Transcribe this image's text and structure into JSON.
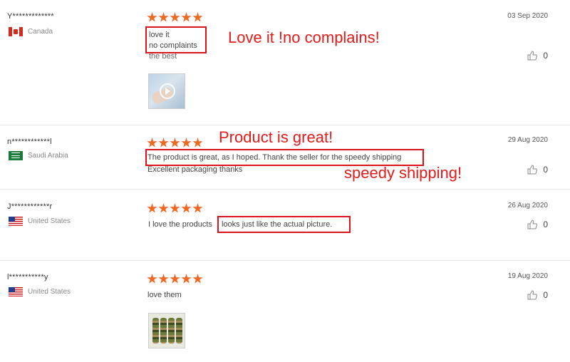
{
  "reviews": [
    {
      "author": "Y*************",
      "country": "Canada",
      "flag": "canada-flag",
      "date": "03 Sep 2020",
      "rating": 5,
      "lines": [
        "love it",
        "no complaints",
        "the best"
      ],
      "likes": "0",
      "has_photo": true
    },
    {
      "author": "n************l",
      "country": "Saudi Arabia",
      "flag": "saudi-arabia-flag",
      "date": "29 Aug 2020",
      "rating": 5,
      "lines": [
        "The product is great, as I hoped. Thank the seller for the speedy shipping",
        "Excellent packaging thanks"
      ],
      "likes": "0",
      "has_photo": false
    },
    {
      "author": "J************r",
      "country": "United States",
      "flag": "us-flag",
      "date": "26 Aug 2020",
      "rating": 5,
      "lines": [
        "I love the products",
        "looks just like the actual picture."
      ],
      "likes": "0",
      "has_photo": false
    },
    {
      "author": "l***********y",
      "country": "United States",
      "flag": "us-flag",
      "date": "19 Aug 2020",
      "rating": 5,
      "lines": [
        "love them"
      ],
      "likes": "0",
      "has_photo": true
    }
  ],
  "annotations": {
    "love_it": "Love it !no complains!",
    "product_great": "Product is great!",
    "speedy": "speedy shipping!"
  },
  "colors": {
    "star": "#f26722",
    "annotation": "#e21b1b",
    "divider": "#e6e6e6"
  }
}
